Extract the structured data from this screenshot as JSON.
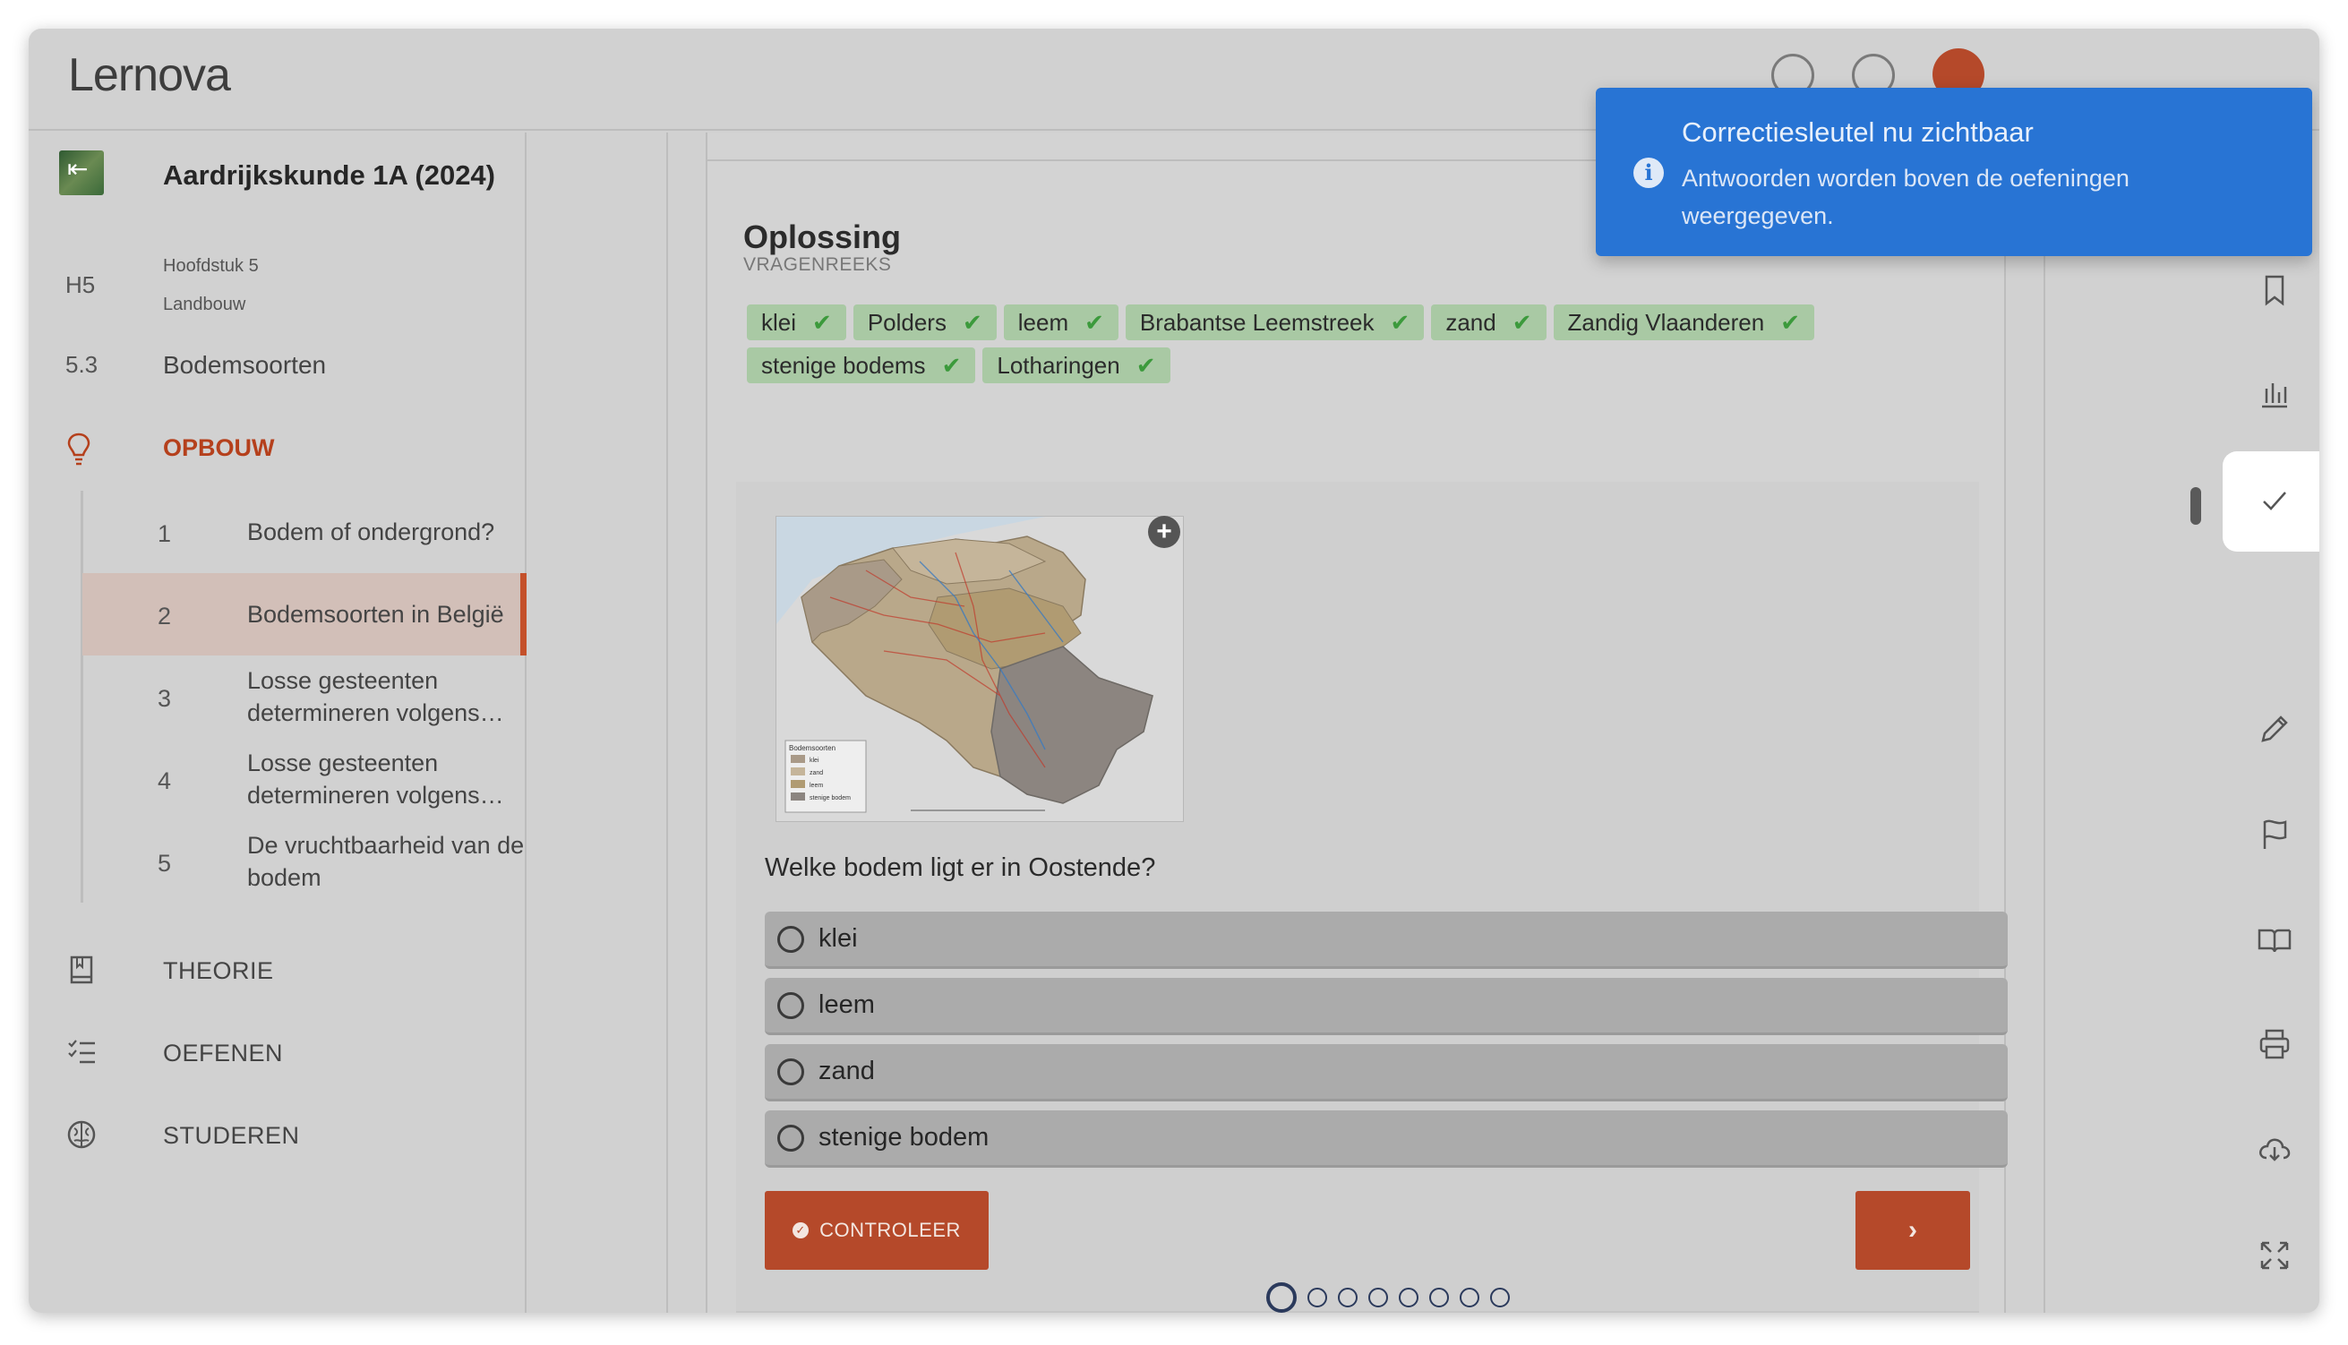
{
  "app": {
    "logo": "Lernova"
  },
  "toast": {
    "title": "Correctiesleutel nu zichtbaar",
    "body": "Antwoorden worden boven de oefeningen weergegeven.",
    "color": "#2874d4"
  },
  "sidebar": {
    "course_title": "Aardrijkskunde 1A (2024)",
    "chapter_code": "H5",
    "chapter_label": "Hoofdstuk 5",
    "chapter_name": "Landbouw",
    "section_code": "5.3",
    "section_title": "Bodemsoorten",
    "opbouw_label": "OPBOUW",
    "sub_items": [
      {
        "num": "1",
        "text": "Bodem of ondergrond?"
      },
      {
        "num": "2",
        "text": "Bodemsoorten in België"
      },
      {
        "num": "3",
        "text": "Losse gesteenten determineren volgens…"
      },
      {
        "num": "4",
        "text": "Losse gesteenten determineren volgens…"
      },
      {
        "num": "5",
        "text": "De vruchtbaarheid van de bodem"
      }
    ],
    "nav": [
      {
        "label": "THEORIE",
        "icon": "book-icon"
      },
      {
        "label": "OEFENEN",
        "icon": "checklist-icon"
      },
      {
        "label": "STUDEREN",
        "icon": "brain-icon"
      }
    ],
    "accent": "#c4502a"
  },
  "solution": {
    "title": "Oplossing",
    "subtitle": "VRAGENREEKS",
    "chips": [
      "klei",
      "Polders",
      "leem",
      "Brabantse Leemstreek",
      "zand",
      "Zandig Vlaanderen",
      "stenige bodems",
      "Lotharingen"
    ]
  },
  "exercise": {
    "map_legend_title": "Bodemsoorten",
    "map_legend": [
      "klei",
      "zand",
      "leem",
      "stenige bodem"
    ],
    "question": "Welke bodem ligt er in Oostende?",
    "options": [
      "klei",
      "leem",
      "zand",
      "stenige bodem"
    ],
    "check_label": "CONTROLEER",
    "pagination_count": 8,
    "pagination_active": 1
  },
  "rail_icons": [
    "bookmark-icon",
    "chart-icon",
    "check-icon",
    "pencil-icon",
    "flag-icon",
    "open-book-icon",
    "printer-icon",
    "cloud-download-icon",
    "expand-icon"
  ]
}
